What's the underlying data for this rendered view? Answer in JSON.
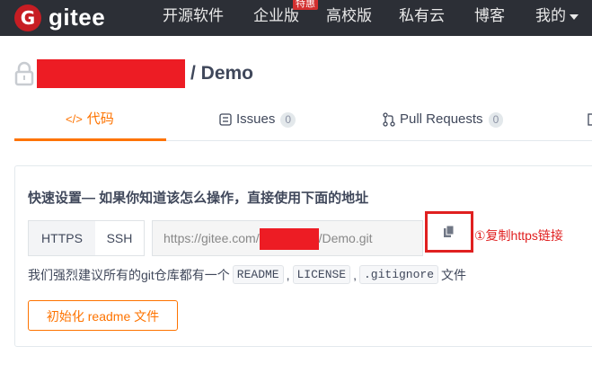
{
  "topbar": {
    "logo_letter": "G",
    "logo_text": "gitee",
    "nav": [
      "开源软件",
      "企业版",
      "高校版",
      "私有云",
      "博客"
    ],
    "badge": "特惠",
    "me_label": "我的"
  },
  "repo": {
    "name_suffix": "/ Demo"
  },
  "tabs": {
    "code_icon": "</>",
    "code_label": "代码",
    "issues_label": "Issues",
    "issues_count": "0",
    "pr_label": "Pull Requests",
    "pr_count": "0"
  },
  "quick_setup": {
    "title": "快速设置— 如果你知道该怎么操作，直接使用下面的地址",
    "https_label": "HTTPS",
    "ssh_label": "SSH",
    "url_prefix": "https://gitee.com/",
    "url_suffix": "/Demo.git",
    "annotation": "①复制https链接",
    "tip_prefix": "我们强烈建议所有的git仓库都有一个",
    "file1": "README",
    "file2": "LICENSE",
    "file3": ".gitignore",
    "tip_suffix": "文件",
    "sep": ",",
    "init_button": "初始化 readme 文件"
  },
  "colors": {
    "accent": "#fe7300",
    "topbar": "#2c2f36",
    "annotation_red": "#e02020",
    "redaction_red": "#ed1c24"
  }
}
